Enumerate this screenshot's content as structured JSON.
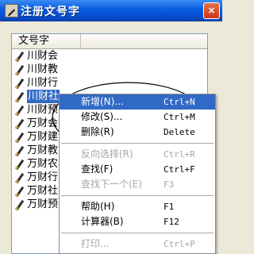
{
  "window": {
    "title": "注册文号字",
    "close_symbol": "×"
  },
  "list": {
    "column_header": "文号字",
    "rows": [
      {
        "label": "川财会"
      },
      {
        "label": "川财教"
      },
      {
        "label": "川财行"
      },
      {
        "label": "川财社"
      },
      {
        "label": "川财预"
      },
      {
        "label": "万财会"
      },
      {
        "label": "万财建"
      },
      {
        "label": "万财教"
      },
      {
        "label": "万财农"
      },
      {
        "label": "万财行"
      },
      {
        "label": "万财社"
      },
      {
        "label": "万财预"
      }
    ],
    "selected_row": "川财社",
    "row_icon": "pen-icon"
  },
  "context_menu": {
    "items": [
      {
        "label": "新增(N)...",
        "shortcut": "Ctrl+N",
        "state": "highlight"
      },
      {
        "label": "修改(S)...",
        "shortcut": "Ctrl+M",
        "state": "normal"
      },
      {
        "label": "删除(R)",
        "shortcut": "Delete",
        "state": "normal"
      },
      {
        "separator": true
      },
      {
        "label": "反向选择(R)",
        "shortcut": "Ctrl+R",
        "state": "disabled"
      },
      {
        "label": "查找(F)",
        "shortcut": "Ctrl+F",
        "state": "normal"
      },
      {
        "label": "查找下一个(E)",
        "shortcut": "F3",
        "state": "disabled"
      },
      {
        "separator": true
      },
      {
        "label": "帮助(H)",
        "shortcut": "F1",
        "state": "normal"
      },
      {
        "label": "计算器(B)",
        "shortcut": "F12",
        "state": "normal"
      },
      {
        "separator": true
      },
      {
        "label": "打印...",
        "shortcut": "Ctrl+P",
        "state": "disabled"
      },
      {
        "label": "打印页面设置",
        "shortcut": "",
        "state": "disabled"
      }
    ]
  },
  "colors": {
    "titlebar": "#0a5ce0",
    "selection": "#316ac5",
    "disabled_text": "#a7a6aa",
    "annotation_ellipse": "#000000"
  }
}
